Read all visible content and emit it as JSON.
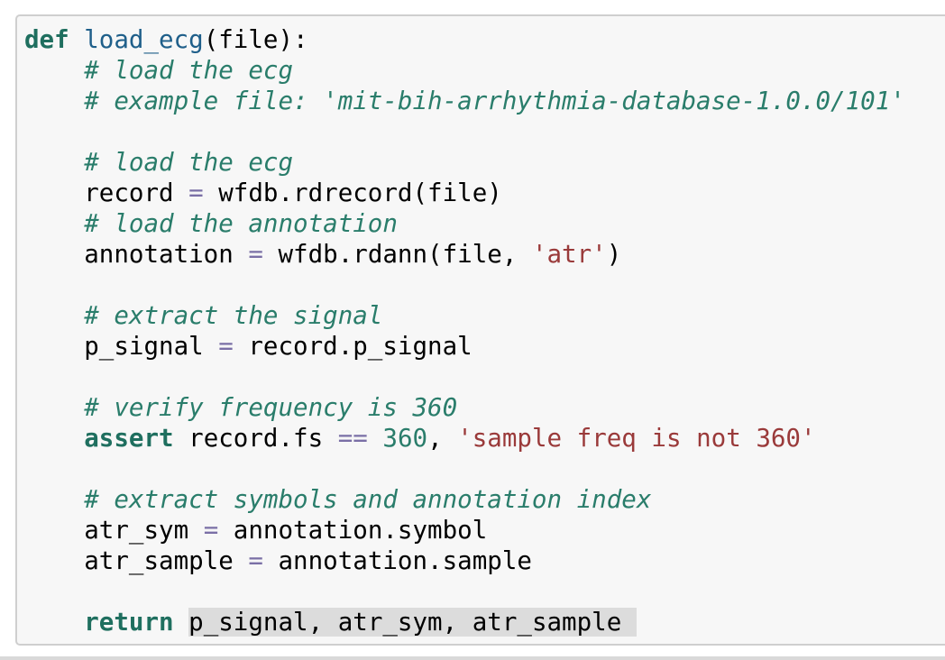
{
  "code_cell": {
    "lines": [
      [
        {
          "t": "def",
          "c": "kw2"
        },
        {
          "t": " ",
          "c": ""
        },
        {
          "t": "load_ecg",
          "c": "fn2"
        },
        {
          "t": "(file):",
          "c": ""
        }
      ],
      [
        {
          "t": "    ",
          "c": ""
        },
        {
          "t": "# load the ecg",
          "c": "cm"
        }
      ],
      [
        {
          "t": "    ",
          "c": ""
        },
        {
          "t": "# example file: 'mit-bih-arrhythmia-database-1.0.0/101'",
          "c": "cm"
        }
      ],
      [],
      [
        {
          "t": "    ",
          "c": ""
        },
        {
          "t": "# load the ecg",
          "c": "cm"
        }
      ],
      [
        {
          "t": "    record ",
          "c": ""
        },
        {
          "t": "=",
          "c": "op"
        },
        {
          "t": " wfdb.rdrecord(file)",
          "c": ""
        }
      ],
      [
        {
          "t": "    ",
          "c": ""
        },
        {
          "t": "# load the annotation",
          "c": "cm"
        }
      ],
      [
        {
          "t": "    annotation ",
          "c": ""
        },
        {
          "t": "=",
          "c": "op"
        },
        {
          "t": " wfdb.rdann(file, ",
          "c": ""
        },
        {
          "t": "'atr'",
          "c": "str2"
        },
        {
          "t": ")",
          "c": ""
        }
      ],
      [],
      [
        {
          "t": "    ",
          "c": ""
        },
        {
          "t": "# extract the signal",
          "c": "cm"
        }
      ],
      [
        {
          "t": "    p_signal ",
          "c": ""
        },
        {
          "t": "=",
          "c": "op"
        },
        {
          "t": " record.p_signal",
          "c": ""
        }
      ],
      [],
      [
        {
          "t": "    ",
          "c": ""
        },
        {
          "t": "# verify frequency is 360",
          "c": "cm"
        }
      ],
      [
        {
          "t": "    ",
          "c": ""
        },
        {
          "t": "assert",
          "c": "kw2"
        },
        {
          "t": " record.fs ",
          "c": ""
        },
        {
          "t": "==",
          "c": "op"
        },
        {
          "t": " ",
          "c": ""
        },
        {
          "t": "360",
          "c": "num"
        },
        {
          "t": ", ",
          "c": ""
        },
        {
          "t": "'sample freq is not 360'",
          "c": "str2"
        }
      ],
      [],
      [
        {
          "t": "    ",
          "c": ""
        },
        {
          "t": "# extract symbols and annotation index",
          "c": "cm"
        }
      ],
      [
        {
          "t": "    atr_sym ",
          "c": ""
        },
        {
          "t": "=",
          "c": "op"
        },
        {
          "t": " annotation.symbol",
          "c": ""
        }
      ],
      [
        {
          "t": "    atr_sample ",
          "c": ""
        },
        {
          "t": "=",
          "c": "op"
        },
        {
          "t": " annotation.sample",
          "c": ""
        }
      ],
      [],
      [
        {
          "t": "    ",
          "c": ""
        },
        {
          "t": "return",
          "c": "kw2"
        },
        {
          "t": " ",
          "c": ""
        },
        {
          "t": "p_signal, atr_sym, atr_sample ",
          "c": "sel"
        }
      ]
    ]
  }
}
